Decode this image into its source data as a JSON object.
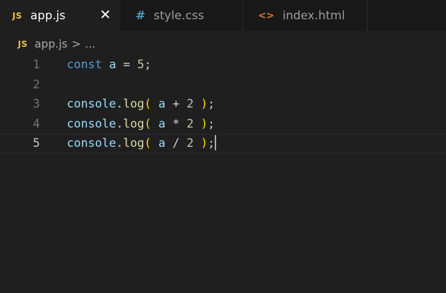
{
  "tabs": [
    {
      "icon": "JS",
      "label": "app.js",
      "close": "✕",
      "active": true
    },
    {
      "icon": "#",
      "label": "style.css",
      "active": false
    },
    {
      "icon": "<>",
      "label": "index.html",
      "active": false
    }
  ],
  "breadcrumb": {
    "icon": "JS",
    "file": "app.js",
    "sep": ">",
    "more": "..."
  },
  "editor": {
    "lines": [
      {
        "num": "1",
        "tokens": [
          [
            "kw",
            "const"
          ],
          [
            "punc",
            " "
          ],
          [
            "var",
            "a"
          ],
          [
            "op",
            " = "
          ],
          [
            "num",
            "5"
          ],
          [
            "punc",
            ";"
          ]
        ]
      },
      {
        "num": "2",
        "tokens": []
      },
      {
        "num": "3",
        "tokens": [
          [
            "obj",
            "console"
          ],
          [
            "punc",
            "."
          ],
          [
            "fn",
            "log"
          ],
          [
            "paren",
            "("
          ],
          [
            "punc",
            " "
          ],
          [
            "var",
            "a"
          ],
          [
            "op",
            " + "
          ],
          [
            "num",
            "2"
          ],
          [
            "punc",
            " "
          ],
          [
            "paren",
            ")"
          ],
          [
            "punc",
            ";"
          ]
        ]
      },
      {
        "num": "4",
        "tokens": [
          [
            "obj",
            "console"
          ],
          [
            "punc",
            "."
          ],
          [
            "fn",
            "log"
          ],
          [
            "paren",
            "("
          ],
          [
            "punc",
            " "
          ],
          [
            "var",
            "a"
          ],
          [
            "op",
            " * "
          ],
          [
            "num",
            "2"
          ],
          [
            "punc",
            " "
          ],
          [
            "paren",
            ")"
          ],
          [
            "punc",
            ";"
          ]
        ]
      },
      {
        "num": "5",
        "tokens": [
          [
            "obj",
            "console"
          ],
          [
            "punc",
            "."
          ],
          [
            "fn",
            "log"
          ],
          [
            "paren",
            "("
          ],
          [
            "punc",
            " "
          ],
          [
            "var",
            "a"
          ],
          [
            "op",
            " / "
          ],
          [
            "num",
            "2"
          ],
          [
            "punc",
            " "
          ],
          [
            "paren",
            ")"
          ],
          [
            "punc",
            ";"
          ]
        ],
        "current": true
      }
    ]
  },
  "colors": {
    "background": "#1f1f1f",
    "tab_inactive": "#181818",
    "js_icon": "#e8c349",
    "css_icon": "#519aba",
    "html_icon": "#e37933",
    "keyword": "#569cd6",
    "variable": "#9cdcfe",
    "function": "#dcdcaa",
    "number": "#b5cea8",
    "bracket": "#ffd700"
  }
}
